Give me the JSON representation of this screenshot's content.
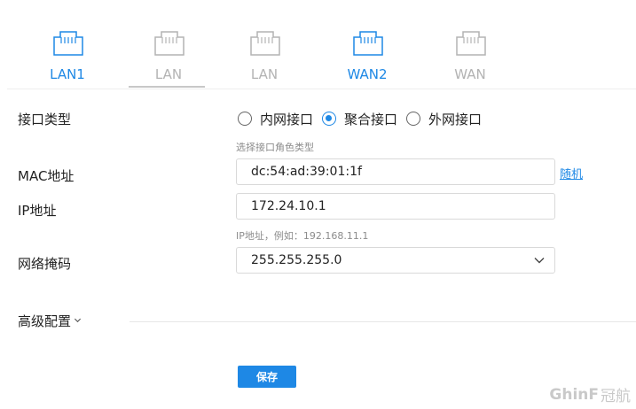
{
  "ports": [
    {
      "label": "LAN1",
      "state": "active"
    },
    {
      "label": "LAN",
      "state": "inactive",
      "selected": true
    },
    {
      "label": "LAN",
      "state": "inactive"
    },
    {
      "label": "WAN2",
      "state": "active"
    },
    {
      "label": "WAN",
      "state": "inactive"
    }
  ],
  "form": {
    "interface_type_label": "接口类型",
    "interface_type_options": [
      "内网接口",
      "聚合接口",
      "外网接口"
    ],
    "interface_type_selected": "聚合接口",
    "interface_type_hint": "选择接口角色类型",
    "mac_label": "MAC地址",
    "mac_value": "dc:54:ad:39:01:1f",
    "mac_random_link": "随机",
    "ip_label": "IP地址",
    "ip_value": "172.24.10.1",
    "ip_hint": "IP地址，例如：192.168.11.1",
    "mask_label": "网络掩码",
    "mask_value": "255.255.255.0",
    "advanced_label": "高级配置",
    "save_label": "保存"
  },
  "watermark": {
    "en": "GhinF",
    "cn": "冠航"
  },
  "colors": {
    "accent": "#1e88e5",
    "inactive": "#b3b3b3"
  },
  "icons": {
    "port": "ethernet-port-icon",
    "dropdown": "chevron-down-icon"
  }
}
